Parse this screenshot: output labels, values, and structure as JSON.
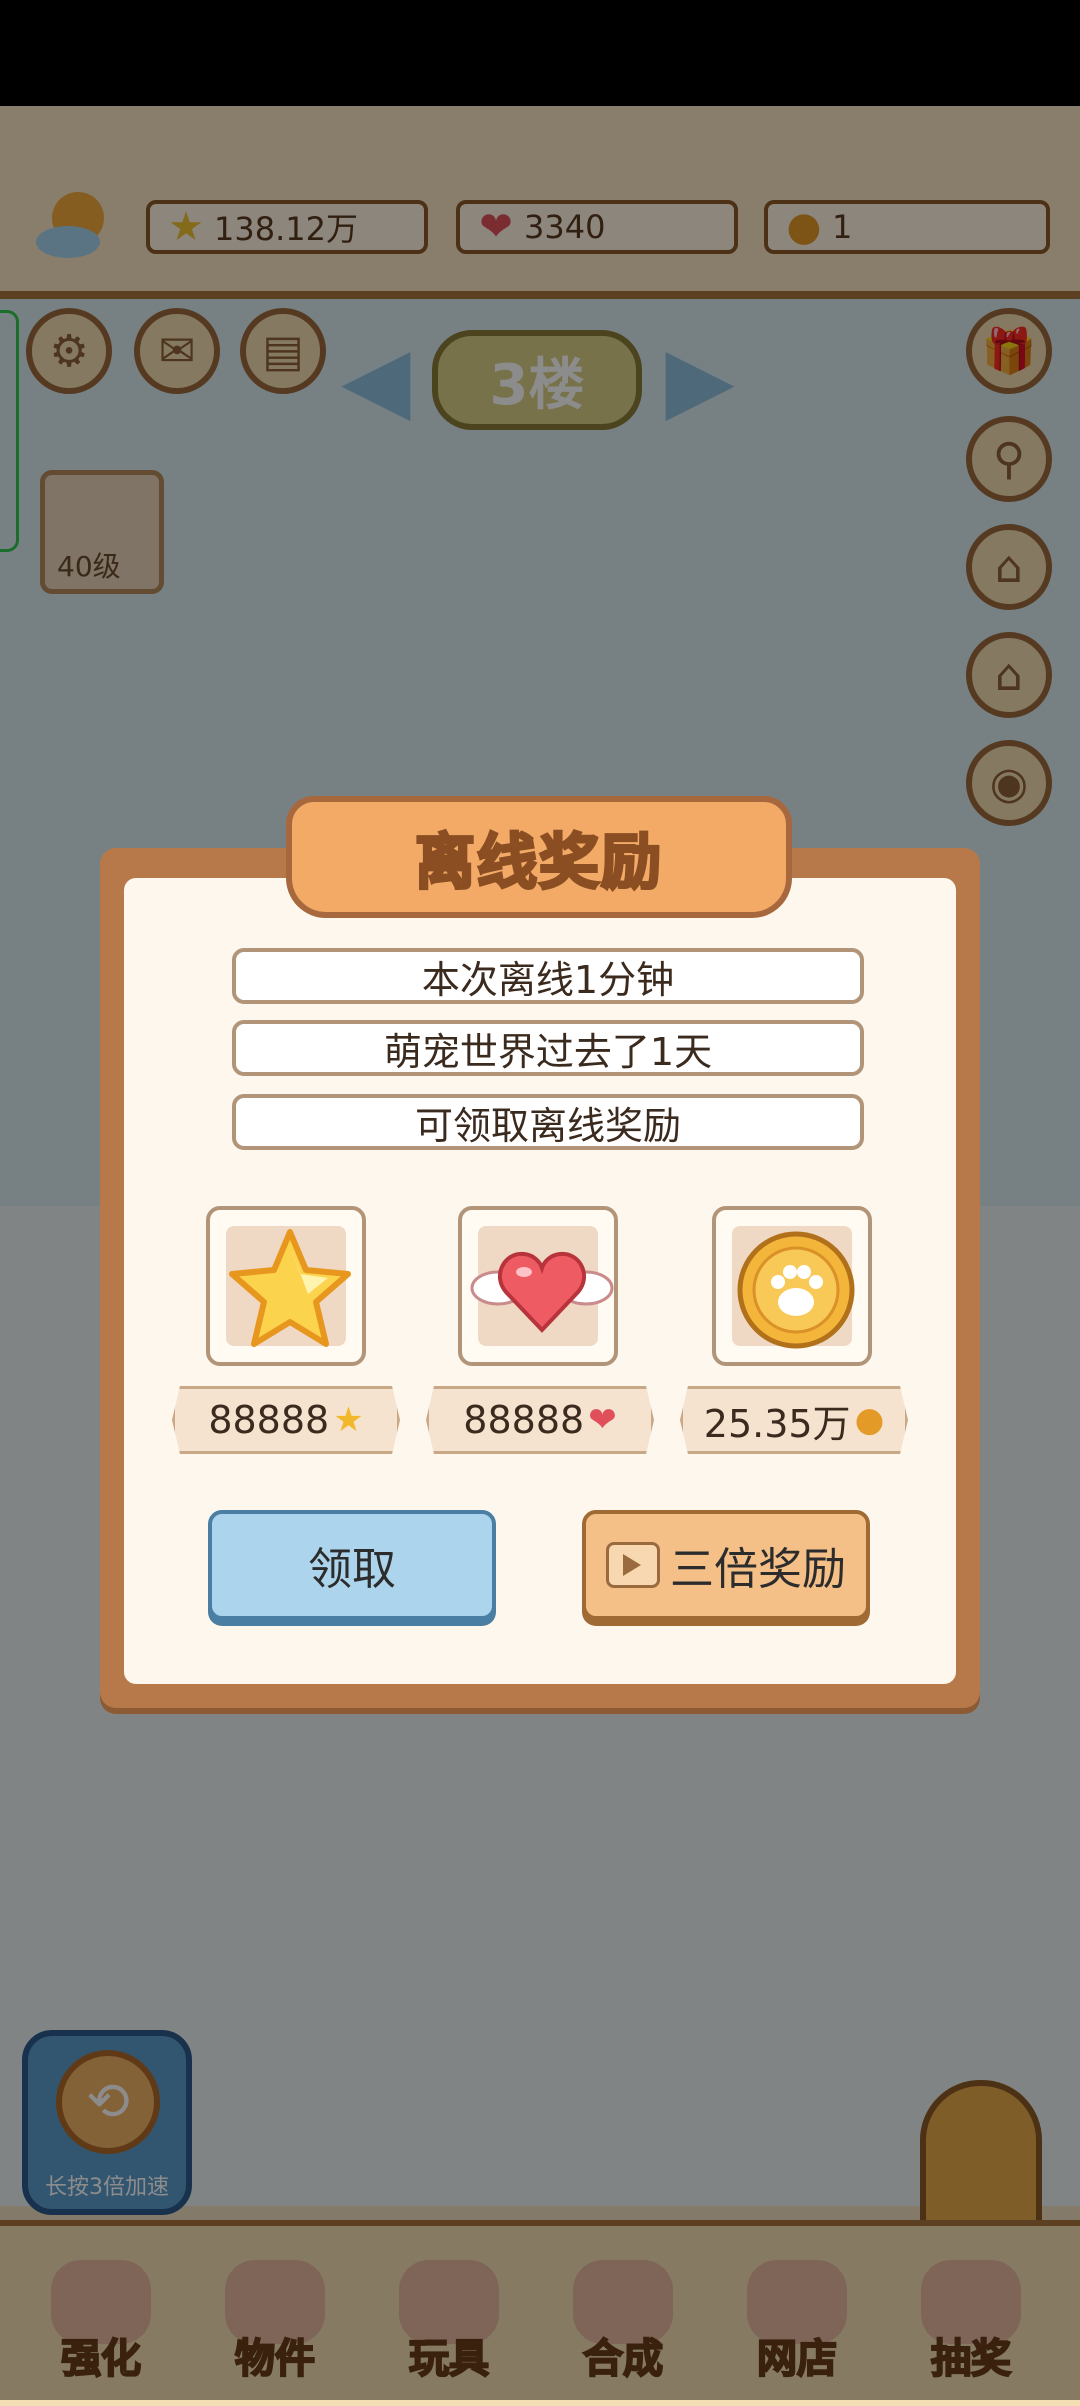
{
  "hud": {
    "stars": "138.12万",
    "hearts": "3340",
    "coins": "1",
    "floor": "3楼",
    "level": "40级"
  },
  "dialog": {
    "title": "离线奖励",
    "lines": [
      "本次离线1分钟",
      "萌宠世界过去了1天",
      "可领取离线奖励"
    ],
    "rewards": [
      {
        "icon": "star-icon",
        "amount": "88888"
      },
      {
        "icon": "winged-heart-icon",
        "amount": "88888"
      },
      {
        "icon": "paw-coin-icon",
        "amount": "25.35万"
      }
    ],
    "claim_label": "领取",
    "triple_label": "三倍奖励"
  },
  "speedup_label": "长按3倍加速",
  "nav": [
    "强化",
    "物件",
    "玩具",
    "合成",
    "网店",
    "抽奖"
  ],
  "colors": {
    "dialog_frame": "#b7794a",
    "title_banner": "#f2aa66",
    "claim_button": "#acd5ed",
    "triple_button": "#f4c087"
  }
}
